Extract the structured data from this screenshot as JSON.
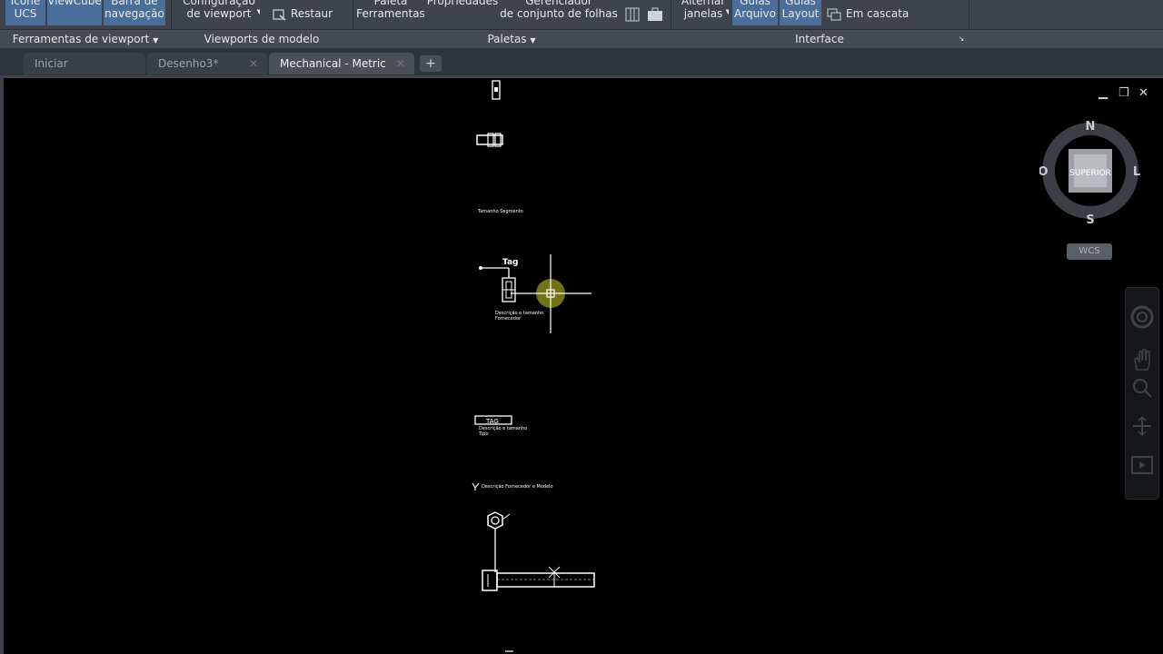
{
  "ribbon": {
    "buttons": [
      {
        "line1": "Ícone",
        "line2": "UCS"
      },
      {
        "line1": "ViewCube",
        "line2": ""
      },
      {
        "line1": "Barra de",
        "line2": "navegação"
      },
      {
        "line1": "Configuração",
        "line2": "de viewport"
      },
      {
        "line1": "Paleta",
        "line2": "Ferramentas"
      },
      {
        "line1": "Propriedades",
        "line2": ""
      },
      {
        "line1": "Gerenciador",
        "line2": "de conjunto de folhas"
      },
      {
        "line1": "Alternar",
        "line2": "janelas"
      },
      {
        "line1": "Guias",
        "line2": "Arquivo"
      },
      {
        "line1": "Guias",
        "line2": "Layout"
      }
    ],
    "restaurar_label": "Restaur",
    "cascata_label": "Em cascata",
    "panels": {
      "viewport_tools": "Ferramentas de viewport",
      "model_viewports": "Viewports de modelo",
      "palettes": "Paletas",
      "interface": "Interface"
    }
  },
  "tabs": [
    {
      "label": "Iniciar"
    },
    {
      "label": "Desenho3*"
    },
    {
      "label": "Mechanical - Metric"
    }
  ],
  "viewcube": {
    "face_label": "SUPERIOR",
    "north": "N",
    "south": "S",
    "east": "L",
    "west": "O",
    "ucs_label": "WCS"
  },
  "drawing": {
    "tag_label": "Tag",
    "tag_box_label": "TAG",
    "desc_text_1": "Descrição e tamanho",
    "desc_text_2": "Fornecedor",
    "desc_text_3": "Tipo",
    "desc_text_4": "Descrição Fornecedor e Modelo",
    "small_heading": "Tamanho Segmento"
  },
  "colors": {
    "ribbon_bg": "#3e434c",
    "active_button": "#4a6e9c",
    "canvas_bg": "#000000",
    "cursor_highlight": "#9a9a1e"
  }
}
